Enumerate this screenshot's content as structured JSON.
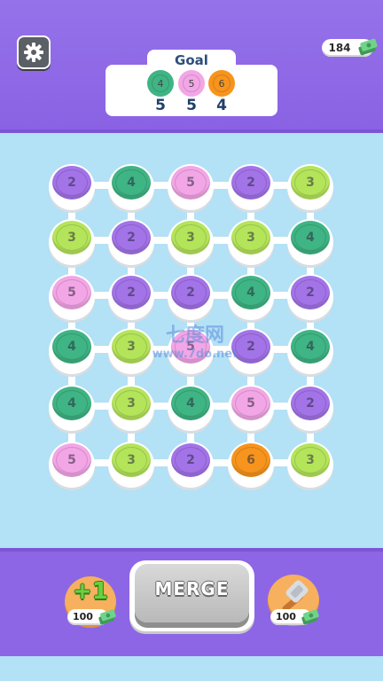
{
  "header": {
    "cash": "184",
    "goal_title": "Goal",
    "goals": [
      {
        "value": "4",
        "count": "5",
        "color": "#3fb484"
      },
      {
        "value": "5",
        "count": "5",
        "color": "#f3a6e6"
      },
      {
        "value": "6",
        "count": "4",
        "color": "#f7941d"
      }
    ]
  },
  "colors": {
    "2": "#a373e8",
    "3": "#b4e45a",
    "4": "#3fb484",
    "5": "#f3a6e6",
    "6": "#f7941d"
  },
  "board": {
    "rows": [
      [
        "2",
        "4",
        "5",
        "2",
        "3"
      ],
      [
        "3",
        "2",
        "3",
        "3",
        "4"
      ],
      [
        "5",
        "2",
        "2",
        "4",
        "2"
      ],
      [
        "4",
        "3",
        "5",
        "2",
        "4"
      ],
      [
        "4",
        "3",
        "4",
        "5",
        "2"
      ],
      [
        "5",
        "3",
        "2",
        "6",
        "3"
      ]
    ]
  },
  "watermark": {
    "line1": "七度网",
    "line2": "www.7do.net"
  },
  "footer": {
    "plus_one_label": "+1",
    "plus_one_price": "100",
    "merge_label": "MERGE",
    "hammer_price": "100"
  }
}
